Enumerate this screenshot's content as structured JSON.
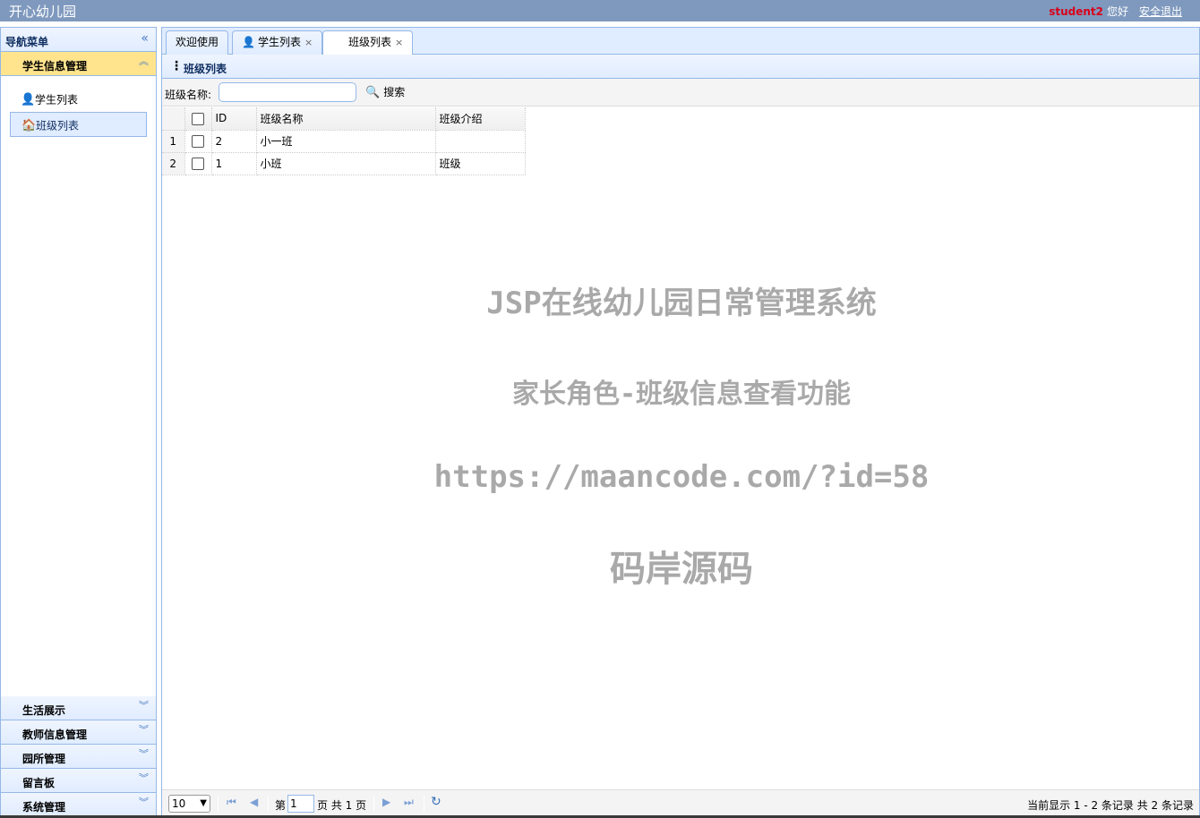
{
  "header": {
    "app_title": "开心幼儿园",
    "username": "student2",
    "greeting": "您好",
    "logout_label": "安全退出"
  },
  "sidebar": {
    "title": "导航菜单",
    "collapse_icon": "double-chevron-left-icon",
    "active_section": "学生信息管理",
    "menu_items": [
      {
        "label": "学生列表",
        "icon": "student-icon"
      },
      {
        "label": "班级列表",
        "icon": "house-icon"
      }
    ],
    "sections": [
      "生活展示",
      "教师信息管理",
      "园所管理",
      "留言板",
      "系统管理"
    ]
  },
  "tabs": [
    {
      "label": "欢迎使用"
    },
    {
      "label": "学生列表",
      "icon": "student-icon",
      "close": "×"
    },
    {
      "label": "班级列表",
      "close": "×"
    }
  ],
  "panel": {
    "title": "班级列表"
  },
  "search": {
    "label": "班级名称:",
    "value": "",
    "button_label": "搜索"
  },
  "grid": {
    "columns": [
      "ID",
      "班级名称",
      "班级介绍"
    ],
    "rows": [
      {
        "rownum": "1",
        "id": "2",
        "name": "小一班",
        "intro": ""
      },
      {
        "rownum": "2",
        "id": "1",
        "name": "小班",
        "intro": "班级"
      }
    ]
  },
  "watermark": {
    "line1": "JSP在线幼儿园日常管理系统",
    "line2": "家长角色-班级信息查看功能",
    "line3": "https://maancode.com/?id=58",
    "line4": "码岸源码"
  },
  "pager": {
    "page_size": "10",
    "page_prefix": "第",
    "page_value": "1",
    "page_suffix": "页 共 1 页",
    "info": "当前显示 1 - 2 条记录 共 2 条记录"
  },
  "colors": {
    "header_bg": "#7f99be",
    "border": "#95b8e7",
    "active_section": "#ffe48d",
    "username": "#d8001a"
  }
}
